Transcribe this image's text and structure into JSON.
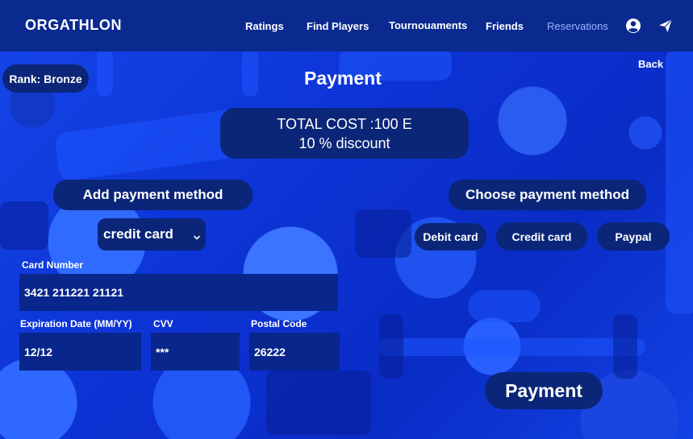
{
  "app": {
    "brand": "ORGATHLON"
  },
  "nav": {
    "items": [
      {
        "label": "Ratings"
      },
      {
        "label": "Find Players"
      },
      {
        "label": "Tournouaments"
      },
      {
        "label": "Friends"
      },
      {
        "label": "Reservations",
        "active": true
      }
    ],
    "icons": [
      "user-circle-icon",
      "send-icon"
    ]
  },
  "rank": {
    "label": "Rank: Bronze"
  },
  "page": {
    "title": "Payment",
    "back_label": "Back"
  },
  "cost": {
    "total": "TOTAL COST :100 E",
    "discount": "10 % discount"
  },
  "add_method": {
    "heading": "Add payment method",
    "select_value": "credit card"
  },
  "form": {
    "card_number_label": "Card Number",
    "card_number_value": "3421 211221 21121",
    "expiration_label": "Expiration Date (MM/YY)",
    "expiration_value": "12/12",
    "cvv_label": "CVV",
    "cvv_value": "***",
    "postal_label": "Postal Code",
    "postal_value": "26222"
  },
  "choose_method": {
    "heading": "Choose payment method",
    "options": [
      "Debit card",
      "Credit card",
      "Paypal"
    ]
  },
  "submit": {
    "label": "Payment"
  },
  "colors": {
    "nav_bg": "#0a2a8f",
    "pill_bg": "#0b2678",
    "field_bg": "#08268c",
    "background": "#0b2fd6",
    "active_nav": "#9cb2ff"
  }
}
